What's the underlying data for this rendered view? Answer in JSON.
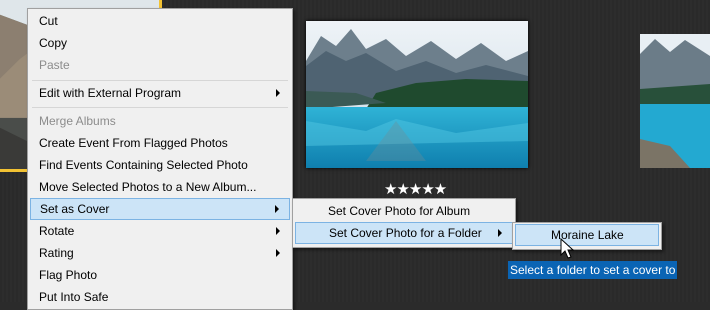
{
  "colors": {
    "selection_border": "#f2c233",
    "menu_bg": "#f0f0f0",
    "menu_highlight": "#cce4f7",
    "tooltip_bg": "#0a64b4"
  },
  "photos": {
    "main_rating": "★★★★★"
  },
  "context_menu": {
    "items": [
      {
        "label": "Cut"
      },
      {
        "label": "Copy"
      },
      {
        "label": "Paste"
      },
      {
        "label": "Edit with External Program"
      },
      {
        "label": "Merge Albums"
      },
      {
        "label": "Create Event From Flagged Photos"
      },
      {
        "label": "Find Events Containing Selected Photo"
      },
      {
        "label": "Move Selected Photos to a New Album..."
      },
      {
        "label": "Set as Cover"
      },
      {
        "label": "Rotate"
      },
      {
        "label": "Rating"
      },
      {
        "label": "Flag Photo"
      },
      {
        "label": "Put Into Safe"
      }
    ]
  },
  "cover_submenu": {
    "items": [
      {
        "label": "Set Cover Photo for Album"
      },
      {
        "label": "Set Cover Photo for a Folder"
      }
    ]
  },
  "folder_submenu": {
    "items": [
      {
        "label": "Moraine Lake"
      }
    ]
  },
  "tooltip": {
    "text": "Select a folder to set a cover to"
  }
}
